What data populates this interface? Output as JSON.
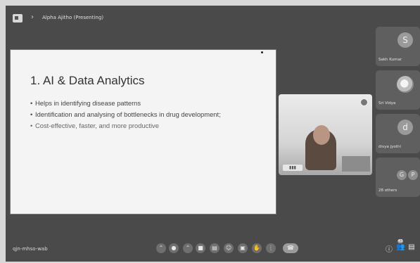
{
  "header": {
    "presenting_label": "Alpha Ajitho (Presenting)"
  },
  "slide": {
    "title": "1. AI & Data Analytics",
    "bullets": [
      "Helps in identifying disease patterns",
      "Identification and analysing of bottlenecks in drug development;",
      "Cost-effective, faster, and more productive"
    ]
  },
  "participants": [
    {
      "initial": "S",
      "name": "Sakh Kumar"
    },
    {
      "initial": "",
      "name": "Sri Vidya"
    },
    {
      "initial": "d",
      "name": "divya jyothi"
    }
  ],
  "others": {
    "initials": [
      "G",
      "P"
    ],
    "label": "28 others"
  },
  "bottom": {
    "meeting_code": "qjn-mhso-wab",
    "notification_count": "43"
  }
}
